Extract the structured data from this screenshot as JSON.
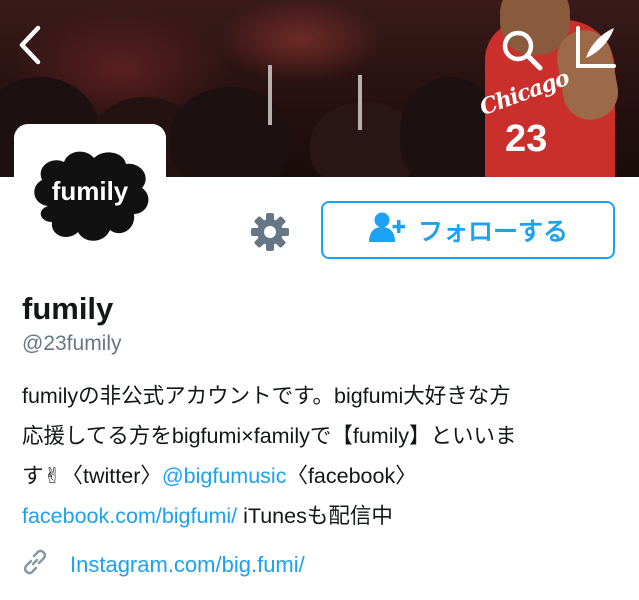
{
  "header": {
    "back_icon": "chevron-left-icon",
    "search_icon": "search-icon",
    "compose_icon": "compose-icon",
    "banner_jersey_text": "Chicago",
    "banner_jersey_number": "23"
  },
  "avatar": {
    "logo_text": "fumily"
  },
  "actions": {
    "settings_icon": "gear-icon",
    "follow_icon": "add-user-icon",
    "follow_label": "フォローする"
  },
  "profile": {
    "name": "fumily",
    "handle": "@23fumily",
    "bio": {
      "line1": "fumilyの非公式アカウントです。bigfumi大好きな方",
      "line2": "応援してる方をbigfumi×familyで【fumily】といいま",
      "line3_prefix": "す✌〈twitter〉",
      "line3_mention": "@bigfumusic",
      "line3_suffix": "〈facebook〉",
      "line4_link": "facebook.com/bigfumi/",
      "line4_suffix": " iTunesも配信中"
    },
    "website_icon": "link-icon",
    "website": "Instagram.com/big.fumi/"
  },
  "colors": {
    "accent": "#1da1f2",
    "text": "#14171a",
    "secondary": "#657786",
    "gear": "#657786"
  }
}
